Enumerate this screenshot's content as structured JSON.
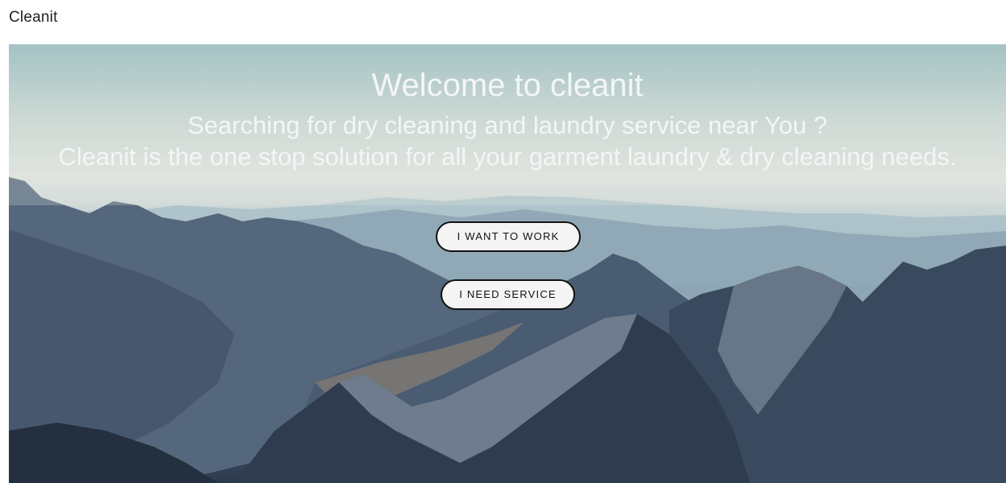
{
  "header": {
    "brand": "Cleanit"
  },
  "hero": {
    "title": "Welcome to cleanit",
    "subtitle": "Searching for dry cleaning and laundry service near You ?",
    "tagline": "Cleanit is the one stop solution for all your garment laundry & dry cleaning needs.",
    "buttons": {
      "work_label": "I WANT TO WORK",
      "service_label": "I NEED SERVICE"
    },
    "background": "mountain-landscape-image"
  },
  "colors": {
    "sky": "#8fb7bc",
    "haze": "#dfe3de",
    "mountain_far": "#9fb5c0",
    "mountain_mid": "#5f7487",
    "mountain_near": "#2f3c50",
    "snow": "#c9d2dc",
    "button_bg": "#f4f4f4",
    "button_border": "#111111",
    "hero_text": "#f3f6f6"
  }
}
